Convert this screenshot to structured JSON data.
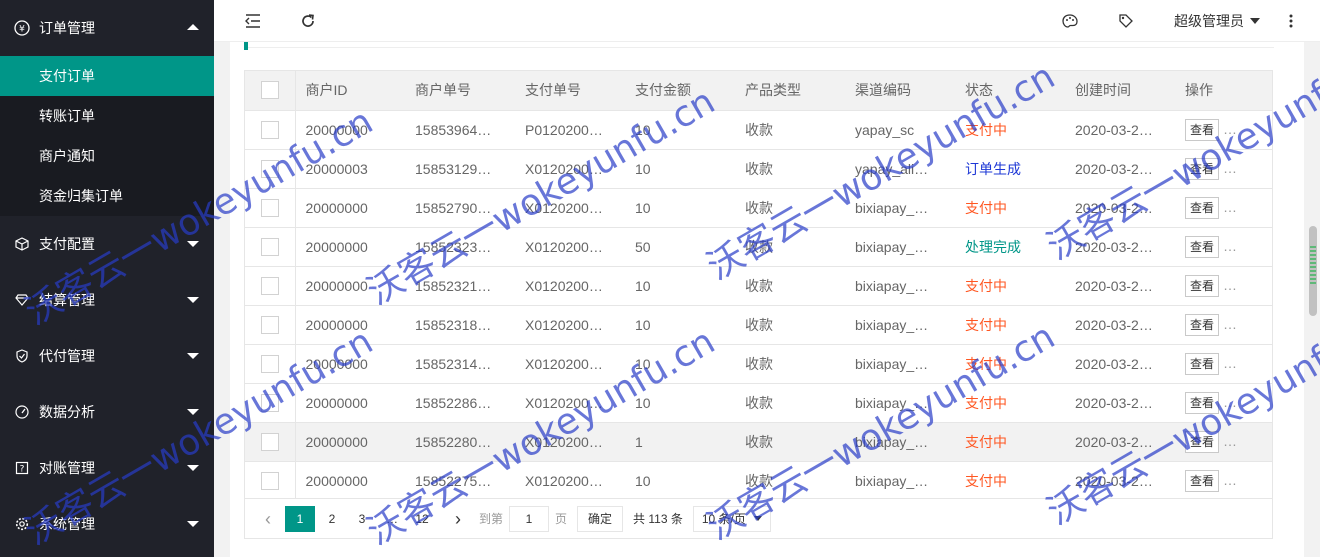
{
  "sidebar": {
    "groups": [
      {
        "label": "订单管理",
        "icon": "yen-icon",
        "open": true
      },
      {
        "label": "支付配置",
        "icon": "cube-icon"
      },
      {
        "label": "结算管理",
        "icon": "diamond-icon"
      },
      {
        "label": "代付管理",
        "icon": "shield-icon"
      },
      {
        "label": "数据分析",
        "icon": "gauge-icon"
      },
      {
        "label": "对账管理",
        "icon": "question-doc-icon"
      },
      {
        "label": "系统管理",
        "icon": "gear-icon"
      }
    ],
    "subitems": [
      {
        "label": "支付订单",
        "active": true
      },
      {
        "label": "转账订单"
      },
      {
        "label": "商户通知"
      },
      {
        "label": "资金归集订单"
      }
    ]
  },
  "topbar": {
    "admin_label": "超级管理员"
  },
  "table": {
    "columns": [
      "商户ID",
      "商户单号",
      "支付单号",
      "支付金额",
      "产品类型",
      "渠道编码",
      "状态",
      "创建时间",
      "操作"
    ],
    "rows": [
      {
        "merchant_id": "20000000",
        "merchant_no": "15853964…",
        "pay_no": "P0120200…",
        "amount": "10",
        "product": "收款",
        "channel": "yapay_sc",
        "status": "支付中",
        "status_type": "pay",
        "created": "2020-03-2…"
      },
      {
        "merchant_id": "20000003",
        "merchant_no": "15853129…",
        "pay_no": "X0120200…",
        "amount": "10",
        "product": "收款",
        "channel": "yapay_ali…",
        "status": "订单生成",
        "status_type": "gen",
        "created": "2020-03-2…"
      },
      {
        "merchant_id": "20000000",
        "merchant_no": "15852790…",
        "pay_no": "X0120200…",
        "amount": "10",
        "product": "收款",
        "channel": "bixiapay_…",
        "status": "支付中",
        "status_type": "pay",
        "created": "2020-03-2…"
      },
      {
        "merchant_id": "20000000",
        "merchant_no": "15852323…",
        "pay_no": "X0120200…",
        "amount": "50",
        "product": "收款",
        "channel": "bixiapay_…",
        "status": "处理完成",
        "status_type": "done",
        "created": "2020-03-2…"
      },
      {
        "merchant_id": "20000000",
        "merchant_no": "15852321…",
        "pay_no": "X0120200…",
        "amount": "10",
        "product": "收款",
        "channel": "bixiapay_…",
        "status": "支付中",
        "status_type": "pay",
        "created": "2020-03-2…"
      },
      {
        "merchant_id": "20000000",
        "merchant_no": "15852318…",
        "pay_no": "X0120200…",
        "amount": "10",
        "product": "收款",
        "channel": "bixiapay_…",
        "status": "支付中",
        "status_type": "pay",
        "created": "2020-03-2…"
      },
      {
        "merchant_id": "20000000",
        "merchant_no": "15852314…",
        "pay_no": "X0120200…",
        "amount": "10",
        "product": "收款",
        "channel": "bixiapay_…",
        "status": "支付中",
        "status_type": "pay",
        "created": "2020-03-2…"
      },
      {
        "merchant_id": "20000000",
        "merchant_no": "15852286…",
        "pay_no": "X0120200…",
        "amount": "10",
        "product": "收款",
        "channel": "bixiapay_…",
        "status": "支付中",
        "status_type": "pay",
        "created": "2020-03-2…"
      },
      {
        "merchant_id": "20000000",
        "merchant_no": "15852280…",
        "pay_no": "X0120200…",
        "amount": "1",
        "product": "收款",
        "channel": "bixiapay_…",
        "status": "支付中",
        "status_type": "pay",
        "created": "2020-03-2…",
        "highlight": true
      },
      {
        "merchant_id": "20000000",
        "merchant_no": "15852275…",
        "pay_no": "X0120200…",
        "amount": "10",
        "product": "收款",
        "channel": "bixiapay_…",
        "status": "支付中",
        "status_type": "pay",
        "created": "2020-03-2…"
      }
    ],
    "view_label": "查看",
    "more_label": "…"
  },
  "pager": {
    "pages": [
      "1",
      "2",
      "3",
      "…",
      "12"
    ],
    "current": "1",
    "goto_label": "到第",
    "goto_value": "1",
    "page_unit": "页",
    "confirm_label": "确定",
    "total_label": "共 113 条",
    "page_size": "10 条/页"
  },
  "watermark": {
    "text": "沃客云一wokeyunfu.cn",
    "short": "fu.cn"
  },
  "colors": {
    "accent": "#009688",
    "sidebar_bg": "#20222a",
    "status_pay": "#ff5722",
    "status_gen": "#1e38d6",
    "status_done": "#009688"
  }
}
